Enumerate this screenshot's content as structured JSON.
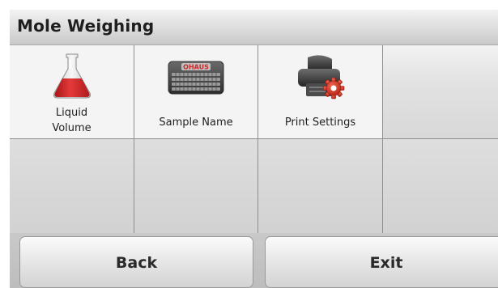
{
  "header": {
    "title": "Mole Weighing"
  },
  "menu": {
    "items": [
      {
        "icon": "flask-icon",
        "label_lines": [
          "Liquid",
          "Volume"
        ]
      },
      {
        "icon": "keyboard-icon",
        "label": "Sample Name",
        "keyboard_text": "OHAUS"
      },
      {
        "icon": "printer-settings-icon",
        "label": "Print Settings"
      }
    ]
  },
  "footer": {
    "back_label": "Back",
    "exit_label": "Exit"
  },
  "colors": {
    "flask_liquid": "#d8252b",
    "gear": "#d83a2a",
    "keyboard_text": "#d0282a"
  }
}
